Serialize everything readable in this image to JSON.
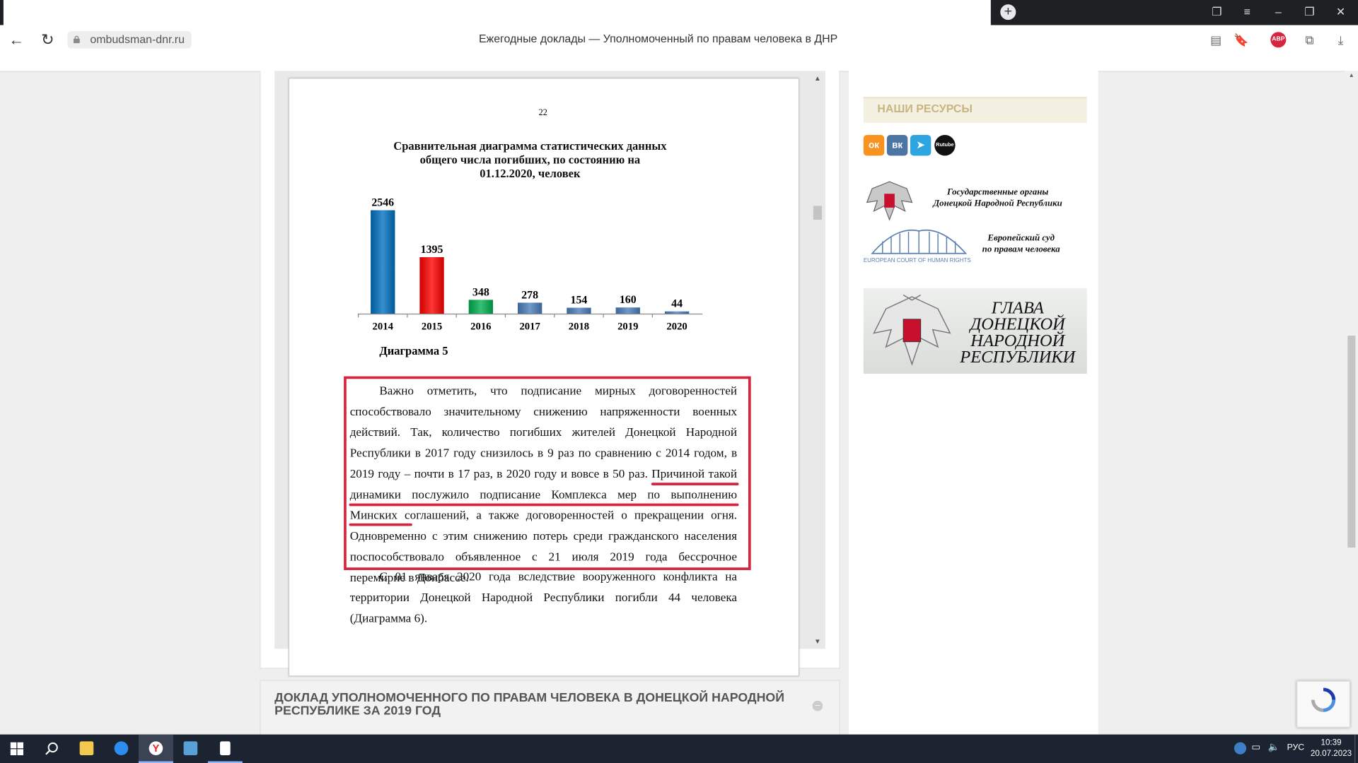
{
  "browser": {
    "url": "ombudsman-dnr.ru",
    "page_title": "Ежегодные доклады — Уполномоченный по правам человека в ДНР",
    "adblock_label": "ABP"
  },
  "document": {
    "page_number": "22",
    "chart_title_lines": [
      "Сравнительная диаграмма статистических данных",
      "общего числа погибших, по состоянию на",
      "01.12.2020, человек"
    ],
    "caption": "Диаграмма 5",
    "paragraph1_before": "Важно отметить, что подписание мирных договоренностей способствовало значительному снижению напряженности военных действий. Так, количество погибших жителей Донецкой Народной Республики в 2017 году снизилось в 9 раз по сравнению с 2014 годом, в 2019 году – почти в 17 раз, в 2020 году и вовсе в 50 раз. ",
    "paragraph1_underlined": "Причиной такой динамики послужило подписание Комплекса мер по выполнению Минских соглашений",
    "paragraph1_after": ", а также договоренностей о прекращении огня. Одновременно с этим снижению потерь среди гражданского населения поспособствовало объявленное с 21 июля 2019 года бессрочное перемирие в Донбассе.",
    "paragraph2": "С 01 января 2020 года вследствие вооруженного конфликта на территории Донецкой Народной Республики погибли 44 человека (Диаграмма 6).",
    "highlight_color": "#d6243f"
  },
  "chart_data": {
    "type": "bar",
    "title": "Сравнительная диаграмма статистических данных общего числа погибших, по состоянию на 01.12.2020, человек",
    "categories": [
      "2014",
      "2015",
      "2016",
      "2017",
      "2018",
      "2019",
      "2020"
    ],
    "values": [
      2546,
      1395,
      348,
      278,
      154,
      160,
      44
    ],
    "colors": [
      "#0070c0",
      "#ff0000",
      "#00b050",
      "#4a7ebb",
      "#4a7ebb",
      "#4a7ebb",
      "#4a7ebb"
    ],
    "data_labels": true,
    "ylim": [
      0,
      2546
    ]
  },
  "accordion": {
    "title": "ДОКЛАД УПОЛНОМОЧЕННОГО ПО ПРАВАМ ЧЕЛОВЕКА В ДОНЕЦКОЙ НАРОДНОЙ РЕСПУБЛИКЕ ЗА 2019 ГОД",
    "toggle": "–"
  },
  "sidebar": {
    "resources_title": "НАШИ РЕСУРСЫ",
    "social": [
      {
        "icon": "odnoklassniki-icon",
        "glyph": "ок",
        "color": "#f7931e"
      },
      {
        "icon": "vk-icon",
        "glyph": "вк",
        "color": "#4c75a3"
      },
      {
        "icon": "telegram-icon",
        "glyph": "➤",
        "color": "#2ca5e0"
      },
      {
        "icon": "rutube-icon",
        "glyph": "Rutube",
        "color": "#111111"
      }
    ],
    "gov_banner_lines": [
      "Государственные органы",
      "Донецкой Народной Республики"
    ],
    "echr_banner_lines": [
      "Европейский суд",
      "по правам человека"
    ],
    "echr_caption": "EUROPEAN COURT OF HUMAN RIGHTS",
    "glava_lines": [
      "ГЛАВА",
      "ДОНЕЦКОЙ",
      "НАРОДНОЙ",
      "РЕСПУБЛИКИ"
    ]
  },
  "taskbar": {
    "language": "РУС",
    "time": "10:39",
    "date": "20.07.2023"
  }
}
